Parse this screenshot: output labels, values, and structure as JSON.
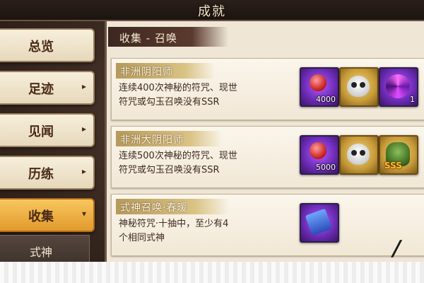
{
  "window": {
    "title": "成就"
  },
  "sidebar": {
    "items": [
      {
        "label": "总览",
        "has_arrow": false,
        "active": false
      },
      {
        "label": "足迹",
        "has_arrow": true,
        "active": false
      },
      {
        "label": "见闻",
        "has_arrow": true,
        "active": false
      },
      {
        "label": "历练",
        "has_arrow": true,
        "active": false
      },
      {
        "label": "收集",
        "has_arrow": true,
        "active": true
      }
    ],
    "arrow_right": "▸",
    "arrow_down": "▾",
    "sub_items": [
      {
        "label": "式神"
      }
    ]
  },
  "main": {
    "section_title": "收集 - 召唤",
    "achievements": [
      {
        "title": "非洲阴阳师",
        "description_line1": "连续400次神秘的符咒、现世",
        "description_line2": "符咒或勾玉召唤没有SSR",
        "rewards": [
          {
            "icon": "red-orb-icon",
            "count": "4000",
            "color": "purple"
          },
          {
            "icon": "daruma-face-icon",
            "count": "",
            "color": "gold"
          },
          {
            "icon": "purple-swirl-icon",
            "count": "1",
            "color": "purple"
          }
        ]
      },
      {
        "title": "非洲大阴阳师",
        "description_line1": "连续500次神秘的符咒、现世",
        "description_line2": "符咒或勾玉召唤没有SSR",
        "rewards": [
          {
            "icon": "red-orb-icon",
            "count": "5000",
            "color": "purple"
          },
          {
            "icon": "daruma-face-icon",
            "count": "",
            "color": "gold"
          },
          {
            "icon": "demon-ssr-icon",
            "count": "",
            "color": "gold",
            "badge": "SSS"
          }
        ]
      },
      {
        "title": "式神召唤·春暖",
        "description_line1": "神秘符咒·十抽中，至少有4",
        "description_line2": "个相同式神",
        "rewards": [
          {
            "icon": "blue-talisman-icon",
            "count": "",
            "color": "purple"
          }
        ]
      }
    ]
  },
  "colors": {
    "accent_active": "#e29a2b",
    "panel_bg": "#efe6d6",
    "title_text": "#f4e7c9"
  }
}
